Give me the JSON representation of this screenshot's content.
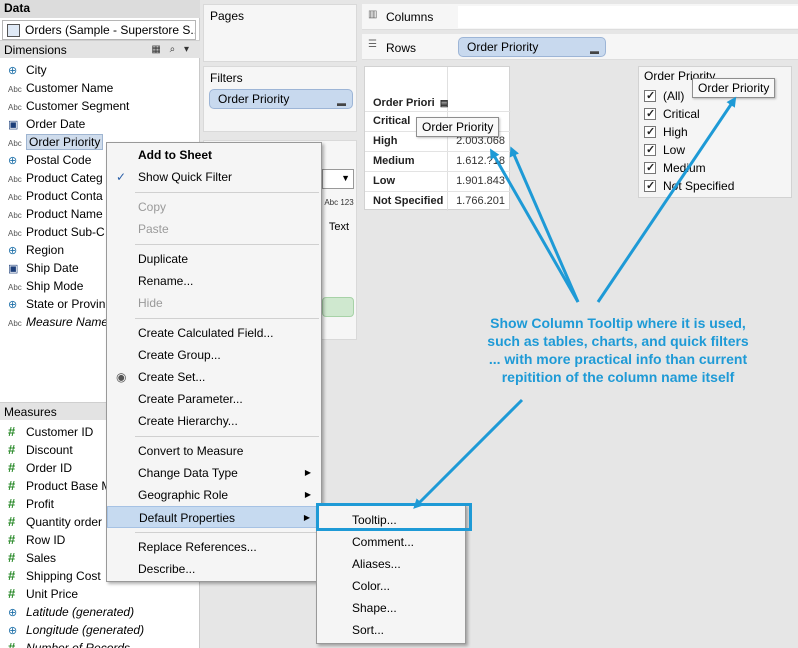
{
  "data_pane": {
    "title": "Data",
    "datasource": "Orders (Sample - Superstore S...",
    "dimensions_label": "Dimensions",
    "dimensions": [
      {
        "label": "City",
        "icon": "globe-icon"
      },
      {
        "label": "Customer Name",
        "icon": "abc-icon"
      },
      {
        "label": "Customer Segment",
        "icon": "abc-icon"
      },
      {
        "label": "Order Date",
        "icon": "calendar-icon"
      },
      {
        "label": "Order Priority",
        "icon": "abc-icon"
      },
      {
        "label": "Postal Code",
        "icon": "globe-icon"
      },
      {
        "label": "Product Categ",
        "icon": "abc-icon"
      },
      {
        "label": "Product Conta",
        "icon": "abc-icon"
      },
      {
        "label": "Product Name",
        "icon": "abc-icon"
      },
      {
        "label": "Product Sub-C",
        "icon": "abc-icon"
      },
      {
        "label": "Region",
        "icon": "globe-icon"
      },
      {
        "label": "Ship Date",
        "icon": "calendar-icon"
      },
      {
        "label": "Ship Mode",
        "icon": "abc-icon"
      },
      {
        "label": "State or Provin",
        "icon": "globe-icon"
      },
      {
        "label": "Measure Name",
        "icon": "abc-icon"
      }
    ],
    "measures_label": "Measures",
    "measures": [
      {
        "label": "Customer ID"
      },
      {
        "label": "Discount"
      },
      {
        "label": "Order ID"
      },
      {
        "label": "Product Base M"
      },
      {
        "label": "Profit"
      },
      {
        "label": "Quantity order"
      },
      {
        "label": "Row ID"
      },
      {
        "label": "Sales"
      },
      {
        "label": "Shipping Cost"
      },
      {
        "label": "Unit Price"
      },
      {
        "label": "Latitude (generated)"
      },
      {
        "label": "Longitude (generated)"
      },
      {
        "label": "Number of Records"
      }
    ],
    "abc": "Abc",
    "hash": "#"
  },
  "shelves": {
    "pages_label": "Pages",
    "filters_label": "Filters",
    "filter_pill": "Order Priority",
    "columns_label": "Columns",
    "rows_label": "Rows",
    "rows_pill": "Order Priority",
    "marks_type_hint": "Abc 123",
    "marks_text": "Text"
  },
  "view_table": {
    "header": "Order Priori",
    "rows": [
      {
        "label": "Critical",
        "value": ""
      },
      {
        "label": "High",
        "value": "2.003.068"
      },
      {
        "label": "Medium",
        "value": "1.612.?18"
      },
      {
        "label": "Low",
        "value": "1.901.843"
      },
      {
        "label": "Not Specified",
        "value": "1.766.201"
      }
    ],
    "tooltip": "Order Priority"
  },
  "quick_filter": {
    "title": "Order Priority",
    "tooltip": "Order Priority",
    "items": [
      "(All)",
      "Critical",
      "High",
      "Low",
      "Medium",
      "Not Specified"
    ]
  },
  "context_menu": {
    "items": [
      {
        "label": "Add to Sheet",
        "style": "bold"
      },
      {
        "label": "Show Quick Filter",
        "style": "checked"
      },
      {
        "label": "Copy",
        "style": "disabled"
      },
      {
        "label": "Paste",
        "style": "disabled"
      },
      {
        "label": "Duplicate"
      },
      {
        "label": "Rename..."
      },
      {
        "label": "Hide",
        "style": "disabled"
      },
      {
        "label": "Create Calculated Field..."
      },
      {
        "label": "Create Group..."
      },
      {
        "label": "Create Set..."
      },
      {
        "label": "Create Parameter..."
      },
      {
        "label": "Create Hierarchy..."
      },
      {
        "label": "Convert to Measure"
      },
      {
        "label": "Change Data Type"
      },
      {
        "label": "Geographic Role"
      },
      {
        "label": "Default Properties"
      },
      {
        "label": "Replace References..."
      },
      {
        "label": "Describe..."
      }
    ],
    "check": "✓",
    "submenu_arrow": "▶"
  },
  "submenu": {
    "items": [
      "Tooltip...",
      "Comment...",
      "Aliases...",
      "Color...",
      "Shape...",
      "Sort..."
    ]
  },
  "annotation": {
    "lines": [
      "Show Column Tooltip where it is used,",
      "such as tables, charts, and quick filters",
      "... with more practical info than current",
      "repitition of the column name itself"
    ],
    "color": "#1e9ad6"
  }
}
